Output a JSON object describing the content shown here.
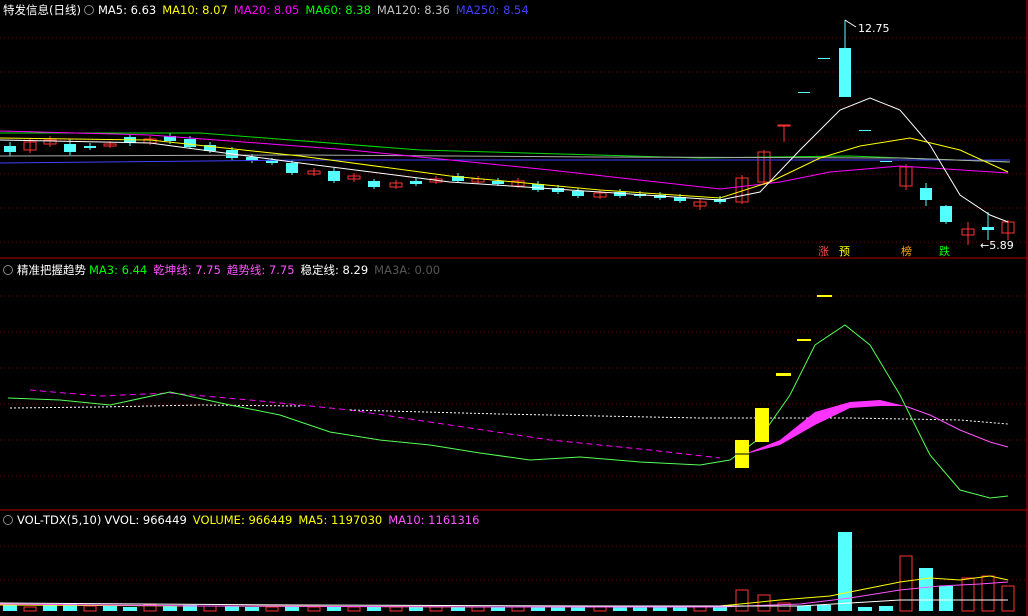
{
  "panel1": {
    "title": "特发信息(日线)",
    "indicators": [
      {
        "name": "MA5",
        "value": "6.63",
        "color": "#ffffff"
      },
      {
        "name": "MA10",
        "value": "8.07",
        "color": "#ffff00"
      },
      {
        "name": "MA20",
        "value": "8.05",
        "color": "#ff00ff"
      },
      {
        "name": "MA60",
        "value": "8.38",
        "color": "#00ff00"
      },
      {
        "name": "MA120",
        "value": "8.36",
        "color": "#c0c0c0"
      },
      {
        "name": "MA250",
        "value": "8.54",
        "color": "#4040ff"
      }
    ],
    "high_label": "12.75",
    "low_label": "5.89",
    "signals": [
      "涨",
      "预",
      "榜",
      "跌"
    ]
  },
  "panel2": {
    "title": "精准把握趋势",
    "indicators": [
      {
        "name": "MA3",
        "value": "6.44",
        "color": "#00ff00"
      },
      {
        "name": "乾坤线",
        "value": "7.75",
        "color": "#ff55ff"
      },
      {
        "name": "趋势线",
        "value": "7.75",
        "color": "#ff55ff"
      },
      {
        "name": "稳定线",
        "value": "8.29",
        "color": "#ffffff"
      },
      {
        "name": "MA3A",
        "value": "0.00",
        "color": "#555555"
      }
    ]
  },
  "panel3": {
    "title": "VOL-TDX(5,10)",
    "indicators": [
      {
        "name": "VVOL",
        "value": "966449",
        "color": "#ffffff"
      },
      {
        "name": "VOLUME",
        "value": "966449",
        "color": "#ffff00"
      },
      {
        "name": "MA5",
        "value": "1197030",
        "color": "#ffff00"
      },
      {
        "name": "MA10",
        "value": "1161316",
        "color": "#ff55ff"
      }
    ]
  },
  "colors": {
    "up": "#ff3232",
    "down": "#54ffff",
    "grid": "#7a0000",
    "border": "#b00000"
  }
}
